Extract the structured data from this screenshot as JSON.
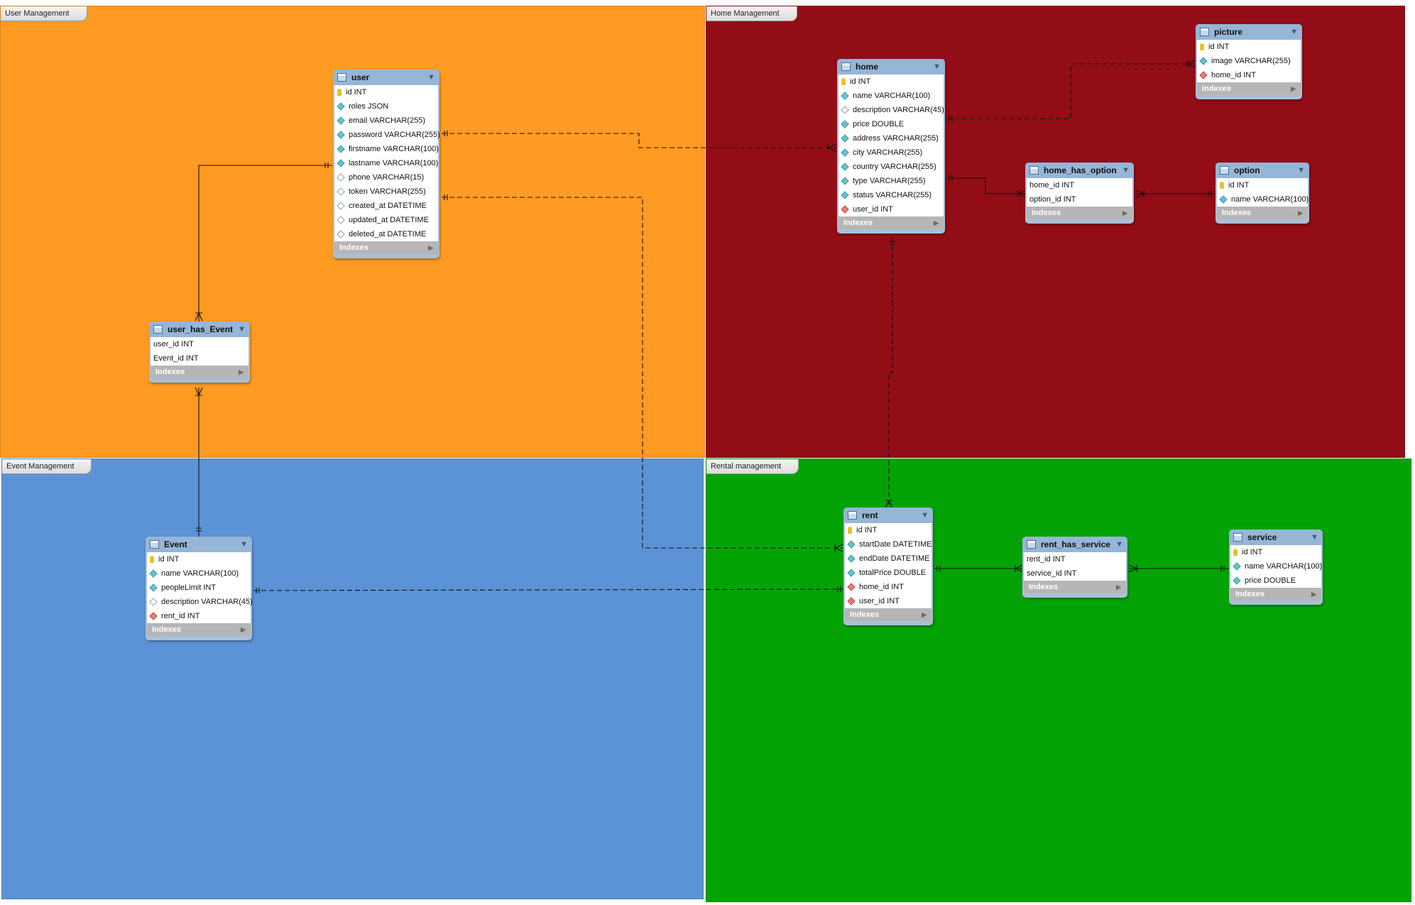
{
  "regions": [
    {
      "id": "user",
      "label": "User Management",
      "color": "#ff9a22"
    },
    {
      "id": "home",
      "label": "Home Management",
      "color": "#930d16"
    },
    {
      "id": "event",
      "label": "Event Management",
      "color": "#5b93d6"
    },
    {
      "id": "rental",
      "label": "Rental management",
      "color": "#04a305"
    }
  ],
  "icons": {
    "table": "table-icon",
    "primary_key": "key-icon",
    "column": "column-diamond-icon",
    "nullable": "nullable-diamond-icon",
    "foreign_key": "foreign-key-diamond-icon",
    "collapse": "chevron-down-icon",
    "expand": "chevron-right-icon"
  },
  "tables": {
    "user": {
      "name": "user",
      "footer": "Indexes",
      "columns": [
        {
          "text": "id INT",
          "kind": "pk"
        },
        {
          "text": "roles JSON",
          "kind": "col"
        },
        {
          "text": "email VARCHAR(255)",
          "kind": "col"
        },
        {
          "text": "password VARCHAR(255)",
          "kind": "col"
        },
        {
          "text": "firstname VARCHAR(100)",
          "kind": "col"
        },
        {
          "text": "lastname VARCHAR(100)",
          "kind": "col"
        },
        {
          "text": "phone VARCHAR(15)",
          "kind": "nul"
        },
        {
          "text": "token VARCHAR(255)",
          "kind": "nul"
        },
        {
          "text": "created_at DATETIME",
          "kind": "nul"
        },
        {
          "text": "updated_at DATETIME",
          "kind": "nul"
        },
        {
          "text": "deleted_at DATETIME",
          "kind": "nul"
        }
      ]
    },
    "user_has_event": {
      "name": "user_has_Event",
      "footer": "Indexes",
      "columns": [
        {
          "text": "user_id INT",
          "kind": "none"
        },
        {
          "text": "Event_id INT",
          "kind": "none"
        }
      ]
    },
    "event": {
      "name": "Event",
      "footer": "Indexes",
      "columns": [
        {
          "text": "id INT",
          "kind": "pk"
        },
        {
          "text": "name VARCHAR(100)",
          "kind": "col"
        },
        {
          "text": "peopleLimit INT",
          "kind": "col"
        },
        {
          "text": "description VARCHAR(45)",
          "kind": "nul"
        },
        {
          "text": "rent_id INT",
          "kind": "fk"
        }
      ]
    },
    "home": {
      "name": "home",
      "footer": "Indexes",
      "columns": [
        {
          "text": "id INT",
          "kind": "pk"
        },
        {
          "text": "name VARCHAR(100)",
          "kind": "col"
        },
        {
          "text": "description VARCHAR(45)",
          "kind": "nul"
        },
        {
          "text": "price DOUBLE",
          "kind": "col"
        },
        {
          "text": "address VARCHAR(255)",
          "kind": "col"
        },
        {
          "text": "city VARCHAR(255)",
          "kind": "col"
        },
        {
          "text": "country VARCHAR(255)",
          "kind": "col"
        },
        {
          "text": "type VARCHAR(255)",
          "kind": "col"
        },
        {
          "text": "status VARCHAR(255)",
          "kind": "col"
        },
        {
          "text": "user_id INT",
          "kind": "fk"
        }
      ]
    },
    "picture": {
      "name": "picture",
      "footer": "Indexes",
      "columns": [
        {
          "text": "id INT",
          "kind": "pk"
        },
        {
          "text": "image VARCHAR(255)",
          "kind": "col"
        },
        {
          "text": "home_id INT",
          "kind": "fk"
        }
      ]
    },
    "home_has_option": {
      "name": "home_has_option",
      "footer": "Indexes",
      "columns": [
        {
          "text": "home_id INT",
          "kind": "none"
        },
        {
          "text": "option_id INT",
          "kind": "none"
        }
      ]
    },
    "option": {
      "name": "option",
      "footer": "Indexes",
      "columns": [
        {
          "text": "id INT",
          "kind": "pk"
        },
        {
          "text": "name VARCHAR(100)",
          "kind": "col"
        }
      ]
    },
    "rent": {
      "name": "rent",
      "footer": "Indexes",
      "columns": [
        {
          "text": "id INT",
          "kind": "pk"
        },
        {
          "text": "startDate DATETIME",
          "kind": "col"
        },
        {
          "text": "endDate DATETIME",
          "kind": "col"
        },
        {
          "text": "totalPrice DOUBLE",
          "kind": "col"
        },
        {
          "text": "home_id INT",
          "kind": "fk"
        },
        {
          "text": "user_id INT",
          "kind": "fk"
        }
      ]
    },
    "rent_has_service": {
      "name": "rent_has_service",
      "footer": "Indexes",
      "columns": [
        {
          "text": "rent_id INT",
          "kind": "none"
        },
        {
          "text": "service_id INT",
          "kind": "none"
        }
      ]
    },
    "service": {
      "name": "service",
      "footer": "Indexes",
      "columns": [
        {
          "text": "id INT",
          "kind": "pk"
        },
        {
          "text": "name VARCHAR(100)",
          "kind": "col"
        },
        {
          "text": "price DOUBLE",
          "kind": "col"
        }
      ]
    }
  },
  "relationships": [
    {
      "from": "user",
      "to": "user_has_event",
      "style": "identifying"
    },
    {
      "from": "event",
      "to": "user_has_event",
      "style": "identifying"
    },
    {
      "from": "user",
      "to": "home",
      "style": "non-identifying"
    },
    {
      "from": "user",
      "to": "rent",
      "style": "non-identifying"
    },
    {
      "from": "home",
      "to": "picture",
      "style": "non-identifying"
    },
    {
      "from": "home",
      "to": "home_has_option",
      "style": "identifying"
    },
    {
      "from": "option",
      "to": "home_has_option",
      "style": "identifying"
    },
    {
      "from": "home",
      "to": "rent",
      "style": "non-identifying"
    },
    {
      "from": "event",
      "to": "rent",
      "style": "non-identifying"
    },
    {
      "from": "rent",
      "to": "rent_has_service",
      "style": "identifying"
    },
    {
      "from": "service",
      "to": "rent_has_service",
      "style": "identifying"
    }
  ]
}
